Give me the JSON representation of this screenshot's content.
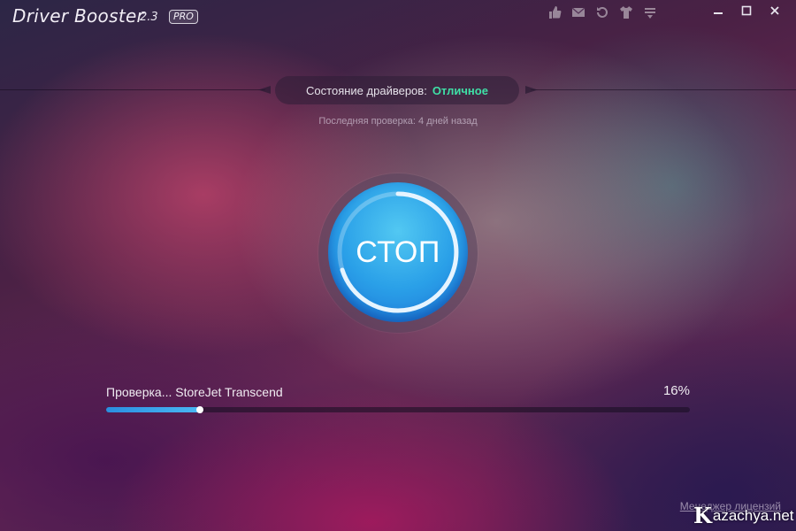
{
  "app": {
    "title": "Driver Booster",
    "version": "2.3",
    "edition": "PRO"
  },
  "toolbar": {
    "icons": [
      "thumbs-up-icon",
      "mail-icon",
      "restore-icon",
      "shirt-icon",
      "menu-icon"
    ]
  },
  "window_controls": [
    "minimize",
    "maximize",
    "close"
  ],
  "status": {
    "label": "Состояние драйверов:",
    "value": "Отличное",
    "value_color": "#3fe0a6",
    "last_check": "Последняя проверка: 4 дней назад"
  },
  "action_button": {
    "label": "СТОП",
    "color": "#2aa0e8"
  },
  "scan": {
    "status_text": "Проверка... StoreJet Transcend",
    "percent_label": "16%",
    "progress": 0.16
  },
  "footer": {
    "license_link": "Менеджер лицензий",
    "watermark_k": "K",
    "watermark_text": "azachya.net"
  }
}
